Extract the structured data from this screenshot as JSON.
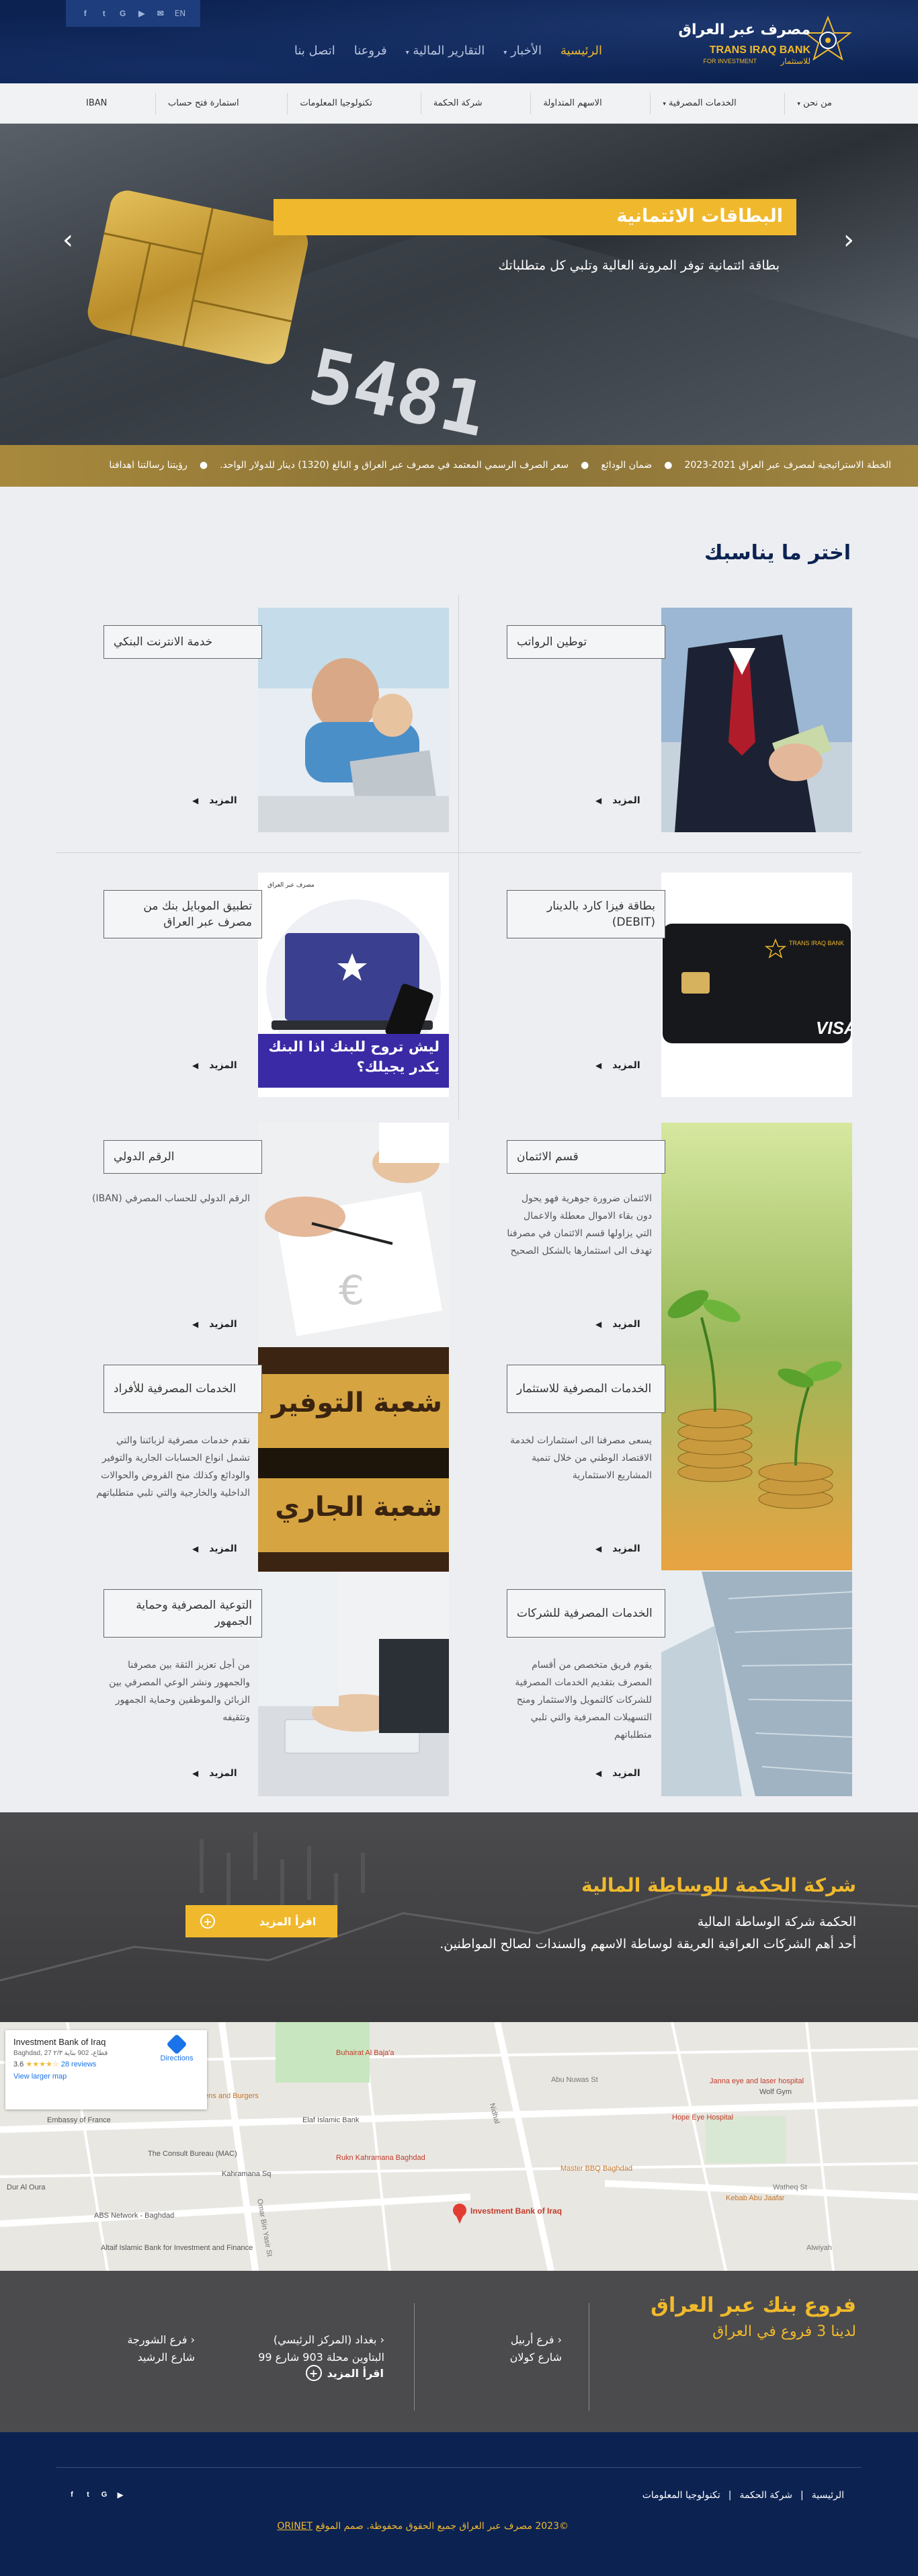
{
  "header": {
    "social": {
      "lang": "EN",
      "icons": [
        "facebook-icon",
        "twitter-icon",
        "google-icon",
        "youtube-icon",
        "email-icon"
      ]
    },
    "nav": [
      {
        "label": "الرئيسية",
        "active": true,
        "dropdown": false
      },
      {
        "label": "الأخبار",
        "active": false,
        "dropdown": true
      },
      {
        "label": "التقارير المالية",
        "active": false,
        "dropdown": true
      },
      {
        "label": "فروعنا",
        "active": false,
        "dropdown": false
      },
      {
        "label": "اتصل بنا",
        "active": false,
        "dropdown": false
      }
    ],
    "logo": {
      "ar": "مصرف عبر العراق",
      "en": "TRANS IRAQ BANK",
      "en_sub": "FOR INVESTMENT",
      "ar_sub": "للاستثمار"
    }
  },
  "subnav": [
    "من نحن",
    "الخدمات المصرفية",
    "الاسهم المتداولة",
    "شركة الحكمة",
    "تكنولوجيا المعلومات",
    "استمارة فتح حساب",
    "IBAN"
  ],
  "hero": {
    "title": "البطاقات الائتمانية",
    "subtitle": "بطاقة ائتمانية توفر المرونة العالية وتلبي كل متطلباتك",
    "card_number": "5481"
  },
  "ticker": [
    "رؤيتنا رسالتنا اهدافنا",
    "سعر الصرف الرسمي المعتمد في مصرف عبر العراق و البالغ (1320) دينار للدولار الواحد.",
    "ضمان الودائع",
    "الخطة الاستراتيجية لمصرف عبر العراق 2021-2023"
  ],
  "section": {
    "title": "اختر ما يناسبك",
    "more": "المزيد",
    "cards": [
      {
        "title": "توطين الرواتب",
        "text": ""
      },
      {
        "title": "خدمة الانترنت البنكي",
        "text": ""
      },
      {
        "title": "بطاقة فيزا كارد بالدينار (DEBIT)",
        "text": ""
      },
      {
        "title": "تطبيق الموبايل بنك من مصرف عبر العراق",
        "text": "",
        "promo": "ليش تروح للبنك اذا البنك يكدر يجيلك؟",
        "bank": "مصرف عبر العراق"
      },
      {
        "title": "قسم الائتمان",
        "text": "الائتمان ضرورة جوهرية فهو يحول دون بقاء الاموال معطلة والاعمال التي يزاولها قسم الائتمان في مصرفنا تهدف الى استثمارها بالشكل الصحيح"
      },
      {
        "title": "الرقم الدولي",
        "text": "الرقم الدولي للحساب المصرفي (IBAN)"
      },
      {
        "title": "الخدمات المصرفية للاستثمار",
        "text": "يسعى مصرفنا الى استثمارات لخدمة الاقتصاد الوطني من خلال تنمية المشاريع الاستثمارية"
      },
      {
        "title": "الخدمات المصرفية للأفراد",
        "text": "نقدم خدمات مصرفية لزبائننا والتي تشمل انواع الحسابات الجارية والتوفير والودائع وكذلك منح القروض والحوالات الداخلية والخارجية والتي تلبي متطلباتهم",
        "sign1": "شعبة التوفير",
        "sign2": "شعبة الجاري"
      },
      {
        "title": "الخدمات المصرفية للشركات",
        "text": "يقوم فريق متخصص من أقسام المصرف بتقديم الخدمات المصرفية للشركات كالتمويل والاستثمار ومنح التسهيلات المصرفية والتي تلبي متطلباتهم"
      },
      {
        "title": "التوعية المصرفية وحماية الجمهور",
        "text": "من أجل تعزيز الثقة بين مصرفنا والجمهور ونشر الوعي المصرفي بين الزبائن والموظفين وحماية الجمهور وتثقيفه"
      }
    ]
  },
  "hikma": {
    "title": "شركة الحكمة للوساطة المالية",
    "line1": "الحكمة شركة الوساطة المالية",
    "line2": "أحد أهم الشركات العراقية العريقة لوساطة الاسهم والسندات لصالح المواطنين.",
    "button": "اقرأ المزيد"
  },
  "map": {
    "place": "Investment Bank of Iraq",
    "address": "Baghdad, 27 قطاع، 902 بناية ٢/٣",
    "rating": "3.6",
    "stars": "★★★★☆",
    "reviews": "28 reviews",
    "directions": "Directions",
    "larger": "View larger map",
    "pin_label": "Investment Bank of Iraq",
    "labels": [
      "Buhairat Al Baja'a",
      "Elaf Islamic Bank",
      "Rukn Kahramana Baghdad",
      "Kahramana Sq",
      "Embassy of France",
      "Ovens and Burgers",
      "The Consult Bureau (MAC)",
      "ABS Network - Baghdad",
      "Altaif Islamic Bank for Investment and Finance",
      "Hope Eye Hospital",
      "Master BBQ Baghdad",
      "Kebab Abu Jaafar",
      "Wolf Gym",
      "Janna eye and laser hospital",
      "Alwiyah",
      "Watheq St",
      "Nidhal",
      "Omar Bin Yasir St",
      "Abu Nuwas St",
      "Dur Al Oura"
    ]
  },
  "branches": {
    "title": "فروع بنك عبر العراق",
    "subtitle": "لدينا 3 فروع في العراق",
    "button": "اقرأ المزيد",
    "items": [
      {
        "name": "فرع أربيل",
        "address": "شارع كولان"
      },
      {
        "name": "بغداد (المركز الرئيسي)",
        "address": "البتاوين محلة 903 شارع 99"
      },
      {
        "name": "فرع الشورجة",
        "address": "شارع الرشيد"
      }
    ]
  },
  "footer": {
    "links": [
      "الرئيسية",
      "شركة الحكمة",
      "تكنولوجيا المعلومات"
    ],
    "copyright": "©2023 مصرف عبر العراق جميع الحقوق محفوظة. صمم الموقع",
    "designer": "ORINET"
  },
  "colors": {
    "navy": "#0c2352",
    "gold": "#f0b92d",
    "grey": "#4b4b4d"
  }
}
